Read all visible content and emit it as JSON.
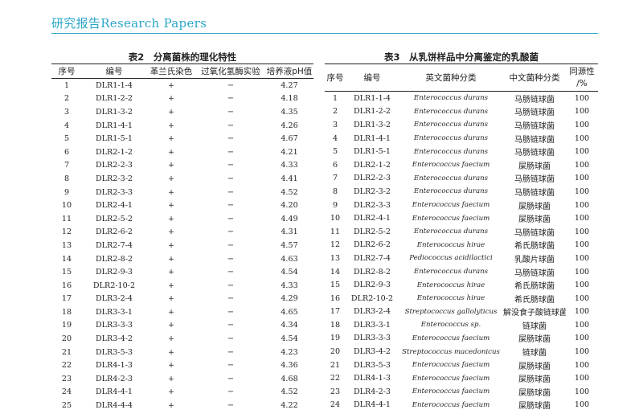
{
  "header": {
    "title": "研究报告Research Papers"
  },
  "table2": {
    "caption": "表2　分离菌株的理化特性",
    "columns": [
      "序号",
      "编号",
      "革兰氏染色",
      "过氧化氢酶实验",
      "培养液pH值"
    ],
    "rows": [
      [
        "1",
        "DLR1-1-4",
        "+",
        "−",
        "4.27"
      ],
      [
        "2",
        "DLR1-2-2",
        "+",
        "−",
        "4.18"
      ],
      [
        "3",
        "DLR1-3-2",
        "+",
        "−",
        "4.35"
      ],
      [
        "4",
        "DLR1-4-1",
        "+",
        "−",
        "4.26"
      ],
      [
        "5",
        "DLR1-5-1",
        "+",
        "−",
        "4.67"
      ],
      [
        "6",
        "DLR2-1-2",
        "+",
        "−",
        "4.21"
      ],
      [
        "7",
        "DLR2-2-3",
        "+",
        "−",
        "4.33"
      ],
      [
        "8",
        "DLR2-3-2",
        "+",
        "−",
        "4.41"
      ],
      [
        "9",
        "DLR2-3-3",
        "+",
        "−",
        "4.52"
      ],
      [
        "10",
        "DLR2-4-1",
        "+",
        "−",
        "4.20"
      ],
      [
        "11",
        "DLR2-5-2",
        "+",
        "−",
        "4.49"
      ],
      [
        "12",
        "DLR2-6-2",
        "+",
        "−",
        "4.31"
      ],
      [
        "13",
        "DLR2-7-4",
        "+",
        "−",
        "4.57"
      ],
      [
        "14",
        "DLR2-8-2",
        "+",
        "−",
        "4.63"
      ],
      [
        "15",
        "DLR2-9-3",
        "+",
        "−",
        "4.54"
      ],
      [
        "16",
        "DLR2-10-2",
        "+",
        "−",
        "4.33"
      ],
      [
        "17",
        "DLR3-2-4",
        "+",
        "−",
        "4.29"
      ],
      [
        "18",
        "DLR3-3-1",
        "+",
        "−",
        "4.65"
      ],
      [
        "19",
        "DLR3-3-3",
        "+",
        "−",
        "4.34"
      ],
      [
        "20",
        "DLR3-4-2",
        "+",
        "−",
        "4.54"
      ],
      [
        "21",
        "DLR3-5-3",
        "+",
        "−",
        "4.23"
      ],
      [
        "22",
        "DLR4-1-3",
        "+",
        "−",
        "4.36"
      ],
      [
        "23",
        "DLR4-2-3",
        "+",
        "−",
        "4.68"
      ],
      [
        "24",
        "DLR4-4-1",
        "+",
        "−",
        "4.52"
      ],
      [
        "25",
        "DLR4-4-4",
        "+",
        "−",
        "4.22"
      ]
    ]
  },
  "table3": {
    "caption": "表3　从乳饼样品中分离鉴定的乳酸菌",
    "columns": [
      "序号",
      "编号",
      "英文菌种分类",
      "中文菌种分类"
    ],
    "col_identity_line1": "同源性",
    "col_identity_line2": "/%",
    "rows": [
      [
        "1",
        "DLR1-1-4",
        "Enterococcus durans",
        "马肠链球菌",
        "100"
      ],
      [
        "2",
        "DLR1-2-2",
        "Enterococcus durans",
        "马肠链球菌",
        "100"
      ],
      [
        "3",
        "DLR1-3-2",
        "Enterococcus durans",
        "马肠链球菌",
        "100"
      ],
      [
        "4",
        "DLR1-4-1",
        "Enterococcus durans",
        "马肠链球菌",
        "100"
      ],
      [
        "5",
        "DLR1-5-1",
        "Enterococcus durans",
        "马肠链球菌",
        "100"
      ],
      [
        "6",
        "DLR2-1-2",
        "Enterococcus faecium",
        "屎肠球菌",
        "100"
      ],
      [
        "7",
        "DLR2-2-3",
        "Enterococcus durans",
        "马肠链球菌",
        "100"
      ],
      [
        "8",
        "DLR2-3-2",
        "Enterococcus durans",
        "马肠链球菌",
        "100"
      ],
      [
        "9",
        "DLR2-3-3",
        "Enterococcus faecium",
        "屎肠球菌",
        "100"
      ],
      [
        "10",
        "DLR2-4-1",
        "Enterococcus faecium",
        "屎肠球菌",
        "100"
      ],
      [
        "11",
        "DLR2-5-2",
        "Enterococcus durans",
        "马肠链球菌",
        "100"
      ],
      [
        "12",
        "DLR2-6-2",
        "Enterococcus hirae",
        "希氏肠球菌",
        "100"
      ],
      [
        "13",
        "DLR2-7-4",
        "Pediococcus acidilactici",
        "乳酸片球菌",
        "100"
      ],
      [
        "14",
        "DLR2-8-2",
        "Enterococcus durans",
        "马肠链球菌",
        "100"
      ],
      [
        "15",
        "DLR2-9-3",
        "Enterococcus hirae",
        "希氏肠球菌",
        "100"
      ],
      [
        "16",
        "DLR2-10-2",
        "Enterococcus hirae",
        "希氏肠球菌",
        "100"
      ],
      [
        "17",
        "DLR3-2-4",
        "Streptococcus gallolyticus",
        "解没食子酸链球菌",
        "100"
      ],
      [
        "18",
        "DLR3-3-1",
        "Enterococcus sp.",
        "链球菌",
        "100"
      ],
      [
        "19",
        "DLR3-3-3",
        "Enterococcus faecium",
        "屎肠球菌",
        "100"
      ],
      [
        "20",
        "DLR3-4-2",
        "Streptococcus macedonicus",
        "链球菌",
        "100"
      ],
      [
        "21",
        "DLR3-5-3",
        "Enterococcus faecium",
        "屎肠球菌",
        "100"
      ],
      [
        "22",
        "DLR4-1-3",
        "Enterococcus faecium",
        "屎肠球菌",
        "100"
      ],
      [
        "23",
        "DLR4-2-3",
        "Enterococcus faecium",
        "屎肠球菌",
        "100"
      ],
      [
        "24",
        "DLR4-4-1",
        "Enterococcus faecium",
        "屎肠球菌",
        "100"
      ]
    ]
  }
}
